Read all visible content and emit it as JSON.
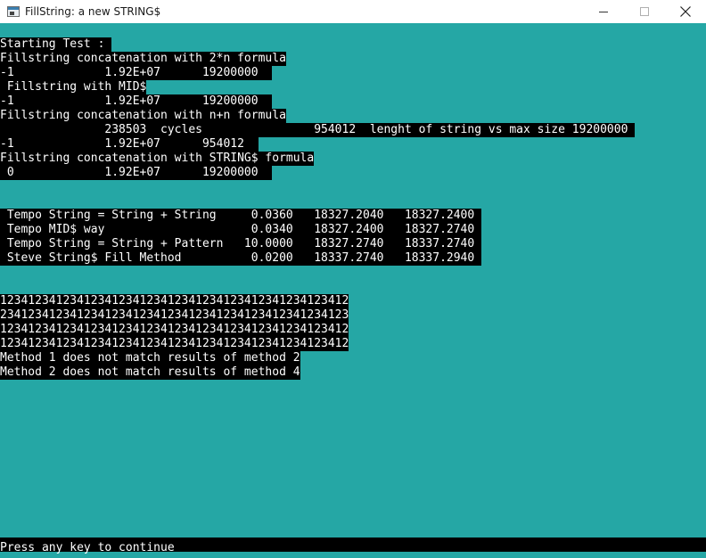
{
  "window": {
    "title": "FillString: a new STRING$",
    "controls": {
      "minimize": "minimize-icon",
      "maximize": "maximize-icon",
      "close": "close-icon"
    }
  },
  "console": {
    "background": "#25a7a5",
    "lines": [
      "Starting Test : ",
      "Fillstring concatenation with 2*n formula",
      "-1             1.92E+07      19200000  ",
      " Fillstring with MID$",
      "-1             1.92E+07      19200000  ",
      "Fillstring concatenation with n+n formula",
      "               238503  cycles                954012  lenght of string vs max size 19200000 ",
      "-1             1.92E+07      954012  ",
      "Fillstring concatenation with STRING$ formula",
      " 0             1.92E+07      19200000  ",
      "",
      "",
      " Tempo String = String + String     0.0360   18327.2040   18327.2400 ",
      " Tempo MID$ way                     0.0340   18327.2400   18327.2740 ",
      " Tempo String = String + Pattern   10.0000   18327.2740   18337.2740 ",
      " Steve String$ Fill Method          0.0200   18337.2740   18337.2940 ",
      "",
      "",
      "12341234123412341234123412341234123412341234123412",
      "23412341234123412341234123412341234123412341234123",
      "12341234123412341234123412341234123412341234123412",
      "12341234123412341234123412341234123412341234123412",
      "Method 1 does not match results of method 2",
      "Method 2 does not match results of method 4"
    ],
    "status": "Press any key to continue"
  }
}
